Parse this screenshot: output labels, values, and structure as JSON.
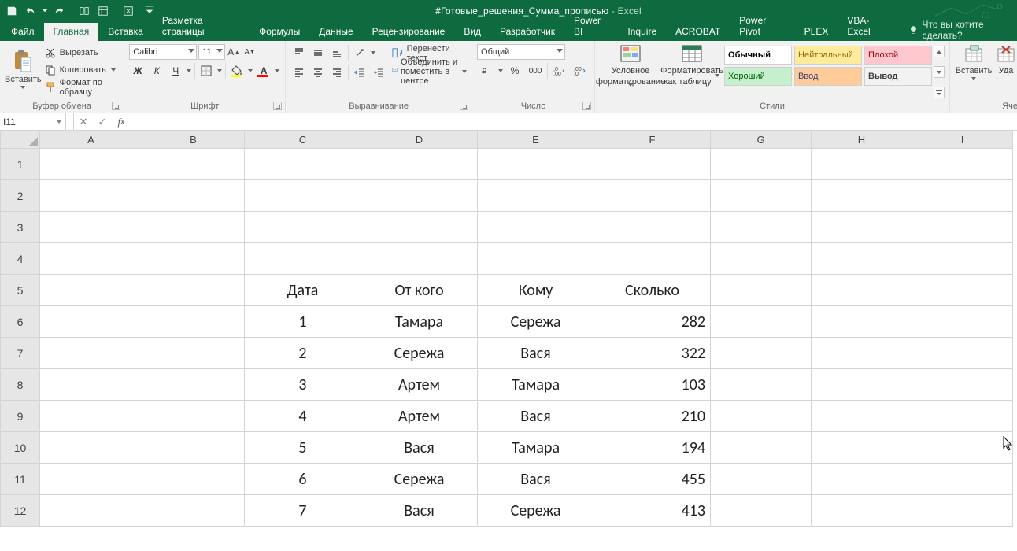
{
  "app": {
    "title_doc": "#Готовые_решения_Сумма_прописью",
    "title_app": "Excel"
  },
  "qat": {
    "save": "save-icon",
    "undo": "undo-icon",
    "redo": "redo-icon",
    "extra1": "touch-mode-icon",
    "extra2": "autosum-icon",
    "extra3": "filter-icon"
  },
  "tabs": {
    "file": "Файл",
    "home": "Главная",
    "insert": "Вставка",
    "layout": "Разметка страницы",
    "formulas": "Формулы",
    "data": "Данные",
    "review": "Рецензирование",
    "view": "Вид",
    "developer": "Разработчик",
    "powerbi": "Power BI",
    "inquire": "Inquire",
    "acrobat": "ACROBAT",
    "powerpivot": "Power Pivot",
    "plex": "PLEX",
    "vbaexcel": "VBA-Excel",
    "tellme": "Что вы хотите сделать?"
  },
  "ribbon": {
    "clipboard": {
      "paste": "Вставить",
      "cut": "Вырезать",
      "copy": "Копировать",
      "format_painter": "Формат по образцу",
      "group": "Буфер обмена"
    },
    "font": {
      "name": "Calibri",
      "size": "11",
      "group": "Шрифт"
    },
    "alignment": {
      "wrap": "Перенести текст",
      "merge": "Объединить и поместить в центре",
      "group": "Выравнивание"
    },
    "number": {
      "format": "Общий",
      "group": "Число"
    },
    "cond": {
      "line1": "Условное",
      "line2": "форматирование"
    },
    "fmt_table": {
      "line1": "Форматировать",
      "line2": "как таблицу"
    },
    "styles": {
      "items": [
        {
          "label": "Обычный",
          "bg": "#ffffff",
          "fg": "#000000",
          "bold": true
        },
        {
          "label": "Нейтральный",
          "bg": "#ffeb9c",
          "fg": "#9c6500"
        },
        {
          "label": "Плохой",
          "bg": "#ffc7ce",
          "fg": "#9c0006"
        },
        {
          "label": "Хороший",
          "bg": "#c6efce",
          "fg": "#006100"
        },
        {
          "label": "Ввод",
          "bg": "#ffcc99",
          "fg": "#3f3f76"
        },
        {
          "label": "Вывод",
          "bg": "#f2f2f2",
          "fg": "#3f3f3f",
          "bold": true
        }
      ],
      "group": "Стили"
    },
    "cells": {
      "insert": "Вставить",
      "delete": "Уда",
      "group": "Яче"
    }
  },
  "fbar": {
    "name": "I11",
    "formula": ""
  },
  "sheet": {
    "cols": [
      "A",
      "B",
      "C",
      "D",
      "E",
      "F",
      "G",
      "H",
      "I"
    ],
    "rows": [
      {
        "n": 1,
        "cells": [
          "",
          "",
          "",
          "",
          "",
          "",
          "",
          "",
          ""
        ]
      },
      {
        "n": 2,
        "cells": [
          "",
          "",
          "",
          "",
          "",
          "",
          "",
          "",
          ""
        ]
      },
      {
        "n": 3,
        "cells": [
          "",
          "",
          "",
          "",
          "",
          "",
          "",
          "",
          ""
        ]
      },
      {
        "n": 4,
        "cells": [
          "",
          "",
          "",
          "",
          "",
          "",
          "",
          "",
          ""
        ]
      },
      {
        "n": 5,
        "cells": [
          "",
          "",
          "Дата",
          "От кого",
          "Кому",
          "Сколько",
          "",
          "",
          ""
        ],
        "header": true
      },
      {
        "n": 6,
        "cells": [
          "",
          "",
          "1",
          "Тамара",
          "Сережа",
          "282",
          "",
          "",
          ""
        ]
      },
      {
        "n": 7,
        "cells": [
          "",
          "",
          "2",
          "Сережа",
          "Вася",
          "322",
          "",
          "",
          ""
        ]
      },
      {
        "n": 8,
        "cells": [
          "",
          "",
          "3",
          "Артем",
          "Тамара",
          "103",
          "",
          "",
          ""
        ]
      },
      {
        "n": 9,
        "cells": [
          "",
          "",
          "4",
          "Артем",
          "Вася",
          "210",
          "",
          "",
          ""
        ]
      },
      {
        "n": 10,
        "cells": [
          "",
          "",
          "5",
          "Вася",
          "Тамара",
          "194",
          "",
          "",
          ""
        ]
      },
      {
        "n": 11,
        "cells": [
          "",
          "",
          "6",
          "Сережа",
          "Вася",
          "455",
          "",
          "",
          ""
        ]
      },
      {
        "n": 12,
        "cells": [
          "",
          "",
          "7",
          "Вася",
          "Сережа",
          "413",
          "",
          "",
          ""
        ]
      }
    ]
  }
}
